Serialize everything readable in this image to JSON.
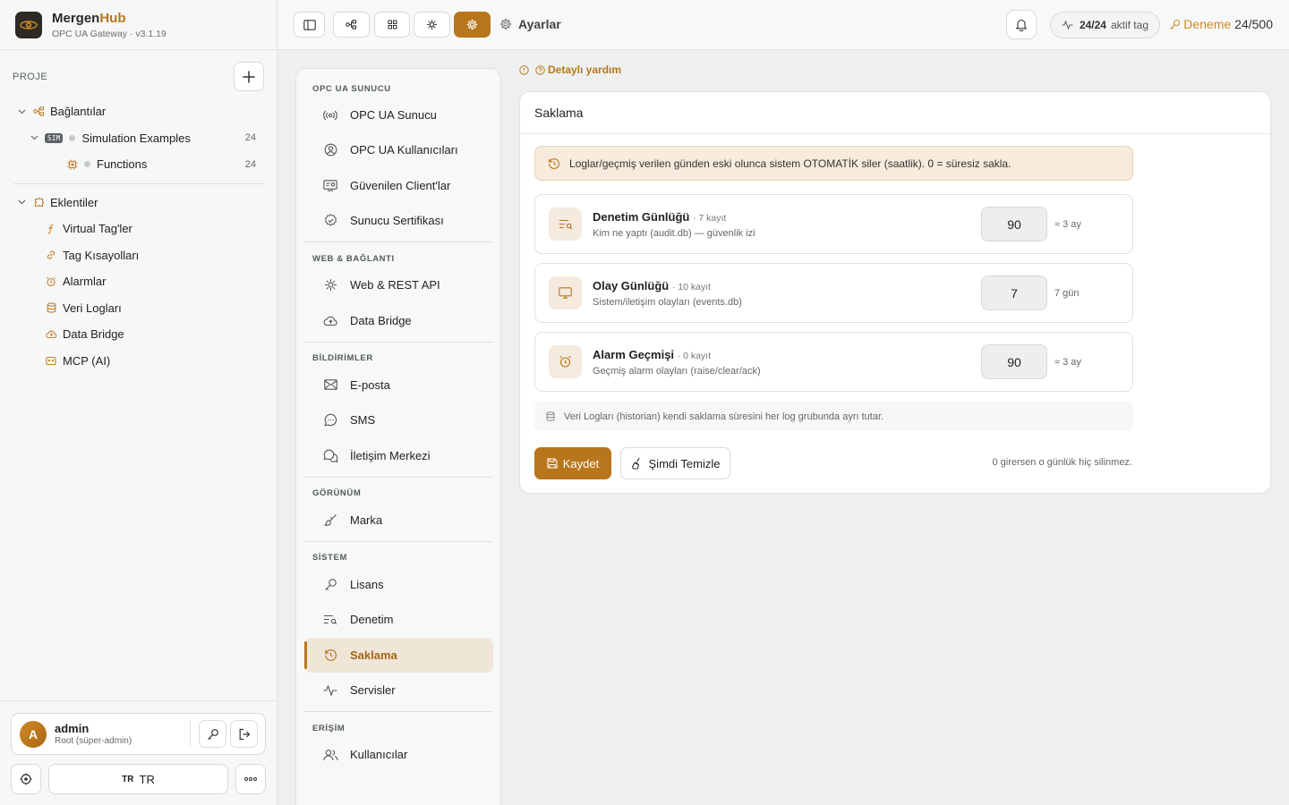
{
  "brand": {
    "name_a": "Mergen",
    "name_b": "Hub",
    "subtitle": "OPC UA Gateway · v3.1.19"
  },
  "project": {
    "label": "PROJE",
    "tree": [
      {
        "label": "Bağlantılar",
        "icon": "connections-icon"
      },
      {
        "label": "Simulation Examples",
        "badge": "SIM",
        "count": "24"
      },
      {
        "label": "Functions",
        "count": "24"
      },
      {
        "label": "Eklentiler",
        "icon": "plugin-icon"
      },
      {
        "label": "Virtual Tag'ler",
        "icon": "function-icon"
      },
      {
        "label": "Tag Kısayolları",
        "icon": "link-icon"
      },
      {
        "label": "Alarmlar",
        "icon": "alarm-icon"
      },
      {
        "label": "Veri Logları",
        "icon": "database-icon"
      },
      {
        "label": "Data Bridge",
        "icon": "cloud-icon"
      },
      {
        "label": "MCP (AI)",
        "icon": "mcp-icon"
      }
    ]
  },
  "user": {
    "initial": "A",
    "name": "admin",
    "role": "Root (süper-admin)"
  },
  "language": {
    "code": "TR",
    "label": "TR"
  },
  "topbar": {
    "title": "Ayarlar",
    "tags_count": "24/24",
    "tags_label": "aktif tag",
    "trial_label": "Deneme",
    "trial_value": "24/500"
  },
  "settings_nav": {
    "groups": [
      {
        "title": "OPC UA SUNUCU",
        "items": [
          "OPC UA Sunucu",
          "OPC UA Kullanıcıları",
          "Güvenilen Client'lar",
          "Sunucu Sertifikası"
        ]
      },
      {
        "title": "WEB & BAĞLANTI",
        "items": [
          "Web & REST API",
          "Data Bridge"
        ]
      },
      {
        "title": "BİLDİRİMLER",
        "items": [
          "E-posta",
          "SMS",
          "İletişim Merkezi"
        ]
      },
      {
        "title": "GÖRÜNÜM",
        "items": [
          "Marka"
        ]
      },
      {
        "title": "SİSTEM",
        "items": [
          "Lisans",
          "Denetim",
          "Saklama",
          "Servisler"
        ]
      },
      {
        "title": "ERİŞİM",
        "items": [
          "Kullanıcılar"
        ]
      }
    ],
    "active": "Saklama"
  },
  "main": {
    "help_link": "Detaylı yardım",
    "card_title": "Saklama",
    "notice": "Loglar/geçmiş verilen günden eski olunca sistem OTOMATİK siler (saatlik). 0 = süresiz sakla.",
    "rows": [
      {
        "title": "Denetim Günlüğü",
        "count": "· 7 kayıt",
        "desc": "Kim ne yaptı (audit.db) — güvenlik izi",
        "value": "90",
        "approx": "≈ 3 ay"
      },
      {
        "title": "Olay Günlüğü",
        "count": "· 10 kayıt",
        "desc": "Sistem/iletişim olayları (events.db)",
        "value": "7",
        "approx": "7 gün"
      },
      {
        "title": "Alarm Geçmişi",
        "count": "· 0 kayıt",
        "desc": "Geçmiş alarm olayları (raise/clear/ack)",
        "value": "90",
        "approx": "≈ 3 ay"
      }
    ],
    "historian_note": "Veri Logları (historian) kendi saklama süresini her log grubunda ayrı tutar.",
    "save_label": "Kaydet",
    "clean_label": "Şimdi Temizle",
    "footer_note": "0 girersen o günlük hiç silinmez."
  },
  "colors": {
    "accent": "#b8761c",
    "accent_soft": "#f0e6d8"
  }
}
